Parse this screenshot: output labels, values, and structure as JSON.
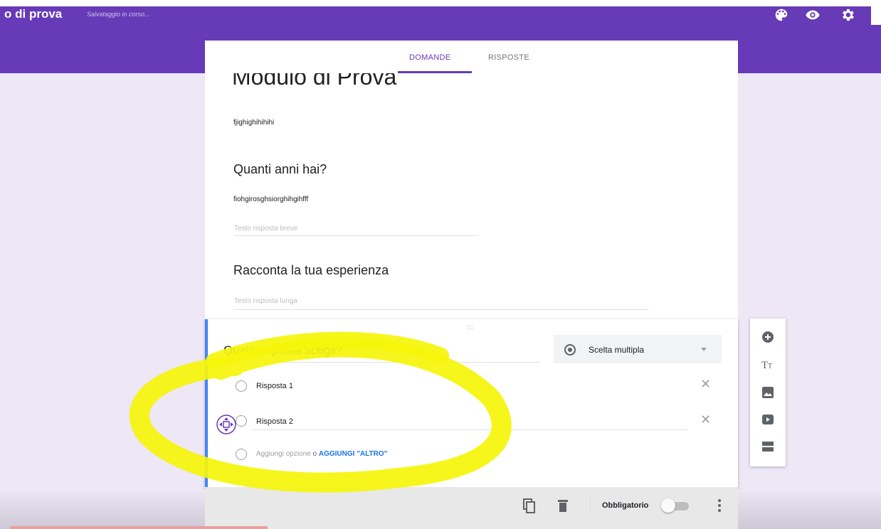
{
  "header": {
    "title": "o di prova",
    "saving_status": "Salvataggio in corso...",
    "icons": [
      "palette-icon",
      "eye-icon",
      "gear-icon"
    ]
  },
  "tabs": [
    {
      "label": "DOMANDE",
      "active": true
    },
    {
      "label": "RISPOSTE",
      "active": false
    }
  ],
  "form": {
    "title": "Modulo di Prova",
    "description": "fjighighihihihi"
  },
  "questions": [
    {
      "title": "Quanti anni hai?",
      "description": "fiohgirosghsiorghihgihfff",
      "answer_placeholder": "Testo risposta breve"
    },
    {
      "title": "Racconta la tua esperienza",
      "answer_placeholder": "Testo risposta lunga"
    }
  ],
  "active_question": {
    "title": "Quale risposta scegli?",
    "type_label": "Scelta multipla",
    "options": [
      "Risposta 1",
      "Risposta 2"
    ],
    "add_option": "Aggiungi opzione",
    "add_or": "o",
    "add_other": "AGGIUNGI \"ALTRO\"",
    "required_label": "Obbligatorio",
    "required": false
  },
  "side_toolbar": [
    "add-question-icon",
    "add-title-icon",
    "add-image-icon",
    "add-video-icon",
    "add-section-icon"
  ],
  "colors": {
    "primary": "#673ab7",
    "background": "#ede7f6",
    "active_bar": "#4285f4",
    "highlight": "#f5f50a",
    "link": "#1a73e8"
  }
}
